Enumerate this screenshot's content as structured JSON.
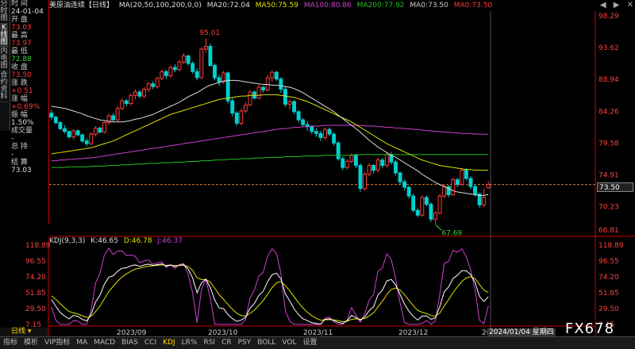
{
  "side_tabs": [
    "分时图",
    "K线图",
    "内电图",
    "合约资料"
  ],
  "info_panel": {
    "fields": [
      {
        "label": "时 间",
        "value": "24-01-04",
        "cls": "white"
      },
      {
        "label": "开 盘",
        "value": "73.03",
        "cls": "red"
      },
      {
        "label": "最 高",
        "value": "73.97",
        "cls": "red"
      },
      {
        "label": "最 低",
        "value": "72.88",
        "cls": "grn"
      },
      {
        "label": "收 盘",
        "value": "73.50",
        "cls": "red"
      },
      {
        "label": "涨 跌",
        "value": "+0.51",
        "cls": "red"
      },
      {
        "label": "涨 幅",
        "value": "+0.69%",
        "cls": "red"
      },
      {
        "label": "振 幅",
        "value": "1.50%",
        "cls": "white"
      },
      {
        "label": "成交量",
        "value": "-",
        "cls": "white"
      },
      {
        "label": "总 持",
        "value": "-",
        "cls": "white"
      },
      {
        "label": "结 算",
        "value": "73.03",
        "cls": "white"
      }
    ]
  },
  "header": {
    "instrument": "美原油连续",
    "period_tag": "【日线】",
    "ma_title": "MA(20,50,100,200,0,0)",
    "ma20": "MA20:72.04",
    "ma50": "MA50:75.59",
    "ma100": "MA100:80.86",
    "ma200": "MA200:77.92",
    "ma0a": "MA0:73.50",
    "ma0b": "MA0:73.50"
  },
  "top_right": {
    "left_arrow": "◀",
    "right_arrow": "▶",
    "close": "✕"
  },
  "price_axis": [
    "98.29",
    "93.62",
    "88.94",
    "84.26",
    "79.58",
    "74.91",
    "70.23",
    "66.81"
  ],
  "current_price_label": "73.50",
  "annotations": {
    "high": "95.01",
    "low": "67.69"
  },
  "kdj": {
    "title": "KDJ(9,3,3)",
    "k": "K:46.65",
    "d": "D:46.78",
    "j": "J:46.37",
    "axis": [
      "118.89",
      "96.55",
      "74.20",
      "51.85",
      "29.50",
      "7.15"
    ]
  },
  "x_axis": [
    "2023/09",
    "2023/10",
    "2023/11",
    "2023/12",
    "20"
  ],
  "cursor_date": "2024/01/04 星期四",
  "period_selector": {
    "label": "日线",
    "arrow": "▾"
  },
  "bottom_tabs": [
    "指标",
    "模析",
    "VIP指标",
    "MA",
    "MACD",
    "BIAS",
    "CCI",
    "KDJ",
    "LR%",
    "RSI",
    "CR",
    "PSY",
    "BOLL",
    "VOL",
    "设置"
  ],
  "watermark": "FX678",
  "colors": {
    "up": "#ff3b3b",
    "down": "#00d0d0",
    "ma20": "#dddddd",
    "ma50": "#e0e000",
    "ma100": "#d040d0",
    "ma200": "#20c020",
    "k": "#ffffff",
    "d": "#e0e000",
    "j": "#d040d0"
  },
  "chart_data": {
    "type": "candlestick",
    "series_note": "",
    "y_range": [
      66.81,
      98.29
    ],
    "candles": [
      [
        84.0,
        84.5,
        83.0,
        83.4
      ],
      [
        83.4,
        83.6,
        82.3,
        82.6
      ],
      [
        82.6,
        82.8,
        81.5,
        81.7
      ],
      [
        81.7,
        82.2,
        81.0,
        81.3
      ],
      [
        81.3,
        81.4,
        80.2,
        80.5
      ],
      [
        80.5,
        81.6,
        80.1,
        81.4
      ],
      [
        81.4,
        81.6,
        80.6,
        80.8
      ],
      [
        80.8,
        81.0,
        79.6,
        79.9
      ],
      [
        79.9,
        80.3,
        79.1,
        79.5
      ],
      [
        79.5,
        81.2,
        79.3,
        80.9
      ],
      [
        80.9,
        82.1,
        80.6,
        81.8
      ],
      [
        81.8,
        82.0,
        81.0,
        81.2
      ],
      [
        81.2,
        82.8,
        81.0,
        82.6
      ],
      [
        82.6,
        83.9,
        82.3,
        83.6
      ],
      [
        83.6,
        84.0,
        82.8,
        83.0
      ],
      [
        83.0,
        85.0,
        82.7,
        84.7
      ],
      [
        84.7,
        86.2,
        84.4,
        85.8
      ],
      [
        85.8,
        86.1,
        85.0,
        85.4
      ],
      [
        85.4,
        86.9,
        85.1,
        86.6
      ],
      [
        86.6,
        87.5,
        86.0,
        87.1
      ],
      [
        87.1,
        87.4,
        86.2,
        86.5
      ],
      [
        86.5,
        87.8,
        86.2,
        87.5
      ],
      [
        87.5,
        88.6,
        87.1,
        88.3
      ],
      [
        88.3,
        88.7,
        87.5,
        87.9
      ],
      [
        87.9,
        89.4,
        87.6,
        89.1
      ],
      [
        89.1,
        90.4,
        88.8,
        90.1
      ],
      [
        90.1,
        90.3,
        89.0,
        89.5
      ],
      [
        89.5,
        91.0,
        89.2,
        90.7
      ],
      [
        90.7,
        91.2,
        90.0,
        90.4
      ],
      [
        90.4,
        91.8,
        90.1,
        91.5
      ],
      [
        91.5,
        92.8,
        91.2,
        92.4
      ],
      [
        92.4,
        92.6,
        91.0,
        91.3
      ],
      [
        91.3,
        91.6,
        89.8,
        90.1
      ],
      [
        90.1,
        90.6,
        88.8,
        89.2
      ],
      [
        89.2,
        93.7,
        89.0,
        93.4
      ],
      [
        93.4,
        95.0,
        92.9,
        93.8
      ],
      [
        93.8,
        94.2,
        90.8,
        91.0
      ],
      [
        91.0,
        91.3,
        88.8,
        89.2
      ],
      [
        89.2,
        89.6,
        88.0,
        88.6
      ],
      [
        88.6,
        90.2,
        88.3,
        89.9
      ],
      [
        89.9,
        90.1,
        85.4,
        85.8
      ],
      [
        85.8,
        86.2,
        83.5,
        84.0
      ],
      [
        84.0,
        84.3,
        82.1,
        82.5
      ],
      [
        82.5,
        84.6,
        82.2,
        84.3
      ],
      [
        84.3,
        85.6,
        84.0,
        85.2
      ],
      [
        85.2,
        87.4,
        85.0,
        87.1
      ],
      [
        87.1,
        87.3,
        86.0,
        86.2
      ],
      [
        86.2,
        88.2,
        86.0,
        87.8
      ],
      [
        87.8,
        88.0,
        87.0,
        87.4
      ],
      [
        87.4,
        89.6,
        87.2,
        89.2
      ],
      [
        89.2,
        90.3,
        88.6,
        90.0
      ],
      [
        90.0,
        90.2,
        88.7,
        89.0
      ],
      [
        89.0,
        89.3,
        87.0,
        87.5
      ],
      [
        87.5,
        87.9,
        84.9,
        85.3
      ],
      [
        85.3,
        86.0,
        84.5,
        85.7
      ],
      [
        85.7,
        85.9,
        83.8,
        84.2
      ],
      [
        84.2,
        84.4,
        82.6,
        83.0
      ],
      [
        83.0,
        83.3,
        82.0,
        82.3
      ],
      [
        82.3,
        82.8,
        81.4,
        82.0
      ],
      [
        82.0,
        82.2,
        80.9,
        81.3
      ],
      [
        81.3,
        81.8,
        80.5,
        81.0
      ],
      [
        81.0,
        81.4,
        79.9,
        80.4
      ],
      [
        80.4,
        81.9,
        80.1,
        81.6
      ],
      [
        81.6,
        81.9,
        80.6,
        80.9
      ],
      [
        80.9,
        81.2,
        79.2,
        79.6
      ],
      [
        79.6,
        79.9,
        77.0,
        77.3
      ],
      [
        77.3,
        77.6,
        75.6,
        76.0
      ],
      [
        76.0,
        77.2,
        75.7,
        76.9
      ],
      [
        76.9,
        78.1,
        76.6,
        77.8
      ],
      [
        77.8,
        78.0,
        75.9,
        76.3
      ],
      [
        76.3,
        76.6,
        72.4,
        72.9
      ],
      [
        72.9,
        75.3,
        72.6,
        75.0
      ],
      [
        75.0,
        76.6,
        74.7,
        76.3
      ],
      [
        76.3,
        76.5,
        75.1,
        75.6
      ],
      [
        75.6,
        77.4,
        75.3,
        77.1
      ],
      [
        77.1,
        77.4,
        75.9,
        76.3
      ],
      [
        76.3,
        78.2,
        76.0,
        77.9
      ],
      [
        77.9,
        78.3,
        76.4,
        76.8
      ],
      [
        76.8,
        77.1,
        74.8,
        75.2
      ],
      [
        75.2,
        75.4,
        73.5,
        73.9
      ],
      [
        73.9,
        74.2,
        72.6,
        73.1
      ],
      [
        73.1,
        73.3,
        71.4,
        71.8
      ],
      [
        71.8,
        72.2,
        69.4,
        69.7
      ],
      [
        69.7,
        70.1,
        68.7,
        69.0
      ],
      [
        69.0,
        71.9,
        68.8,
        71.6
      ],
      [
        71.6,
        71.9,
        70.3,
        70.6
      ],
      [
        70.6,
        70.9,
        68.0,
        68.4
      ],
      [
        68.4,
        69.6,
        67.7,
        69.3
      ],
      [
        69.3,
        72.1,
        69.1,
        71.8
      ],
      [
        71.8,
        73.5,
        71.5,
        73.2
      ],
      [
        73.2,
        73.4,
        71.6,
        72.0
      ],
      [
        72.0,
        74.5,
        71.8,
        74.2
      ],
      [
        74.2,
        74.5,
        73.1,
        73.5
      ],
      [
        73.5,
        75.9,
        73.3,
        75.6
      ],
      [
        75.6,
        75.9,
        74.1,
        74.4
      ],
      [
        74.4,
        74.7,
        72.8,
        73.2
      ],
      [
        73.2,
        73.5,
        71.7,
        72.1
      ],
      [
        72.1,
        72.3,
        70.1,
        70.5
      ],
      [
        70.5,
        72.9,
        70.2,
        71.6
      ],
      [
        73.03,
        73.97,
        72.88,
        73.5
      ]
    ],
    "ma20": [
      85.0,
      84.9,
      84.8,
      84.7,
      84.5,
      84.3,
      84.1,
      83.9,
      83.6,
      83.4,
      83.2,
      83.0,
      82.9,
      82.8,
      82.7,
      82.7,
      82.7,
      82.8,
      82.9,
      83.1,
      83.2,
      83.4,
      83.6,
      83.8,
      84.1,
      84.4,
      84.7,
      85.0,
      85.3,
      85.6,
      86.0,
      86.4,
      86.7,
      87.0,
      87.4,
      87.8,
      88.1,
      88.3,
      88.5,
      88.7,
      88.8,
      88.8,
      88.8,
      88.7,
      88.6,
      88.5,
      88.4,
      88.3,
      88.2,
      88.2,
      88.1,
      88.1,
      88.0,
      87.9,
      87.8,
      87.6,
      87.3,
      87.0,
      86.6,
      86.2,
      85.8,
      85.4,
      85.0,
      84.6,
      84.2,
      83.7,
      83.2,
      82.7,
      82.2,
      81.7,
      81.2,
      80.6,
      80.0,
      79.5,
      79.0,
      78.6,
      78.2,
      77.8,
      77.5,
      77.1,
      76.7,
      76.3,
      75.9,
      75.5,
      75.0,
      74.6,
      74.2,
      73.8,
      73.5,
      73.2,
      72.9,
      72.6,
      72.4,
      72.3,
      72.2,
      72.1,
      72.0,
      71.9,
      71.9,
      72.04
    ],
    "ma50": [
      78.0,
      78.1,
      78.2,
      78.3,
      78.4,
      78.5,
      78.6,
      78.7,
      78.8,
      78.9,
      79.1,
      79.3,
      79.5,
      79.7,
      79.9,
      80.2,
      80.5,
      80.8,
      81.1,
      81.4,
      81.7,
      82.0,
      82.3,
      82.6,
      82.9,
      83.2,
      83.5,
      83.8,
      84.0,
      84.2,
      84.4,
      84.6,
      84.8,
      85.0,
      85.2,
      85.4,
      85.6,
      85.8,
      86.0,
      86.1,
      86.2,
      86.3,
      86.4,
      86.5,
      86.5,
      86.6,
      86.6,
      86.6,
      86.7,
      86.7,
      86.7,
      86.7,
      86.6,
      86.5,
      86.4,
      86.3,
      86.1,
      85.9,
      85.7,
      85.4,
      85.1,
      84.8,
      84.5,
      84.2,
      83.9,
      83.6,
      83.3,
      83.0,
      82.7,
      82.3,
      81.9,
      81.5,
      81.1,
      80.7,
      80.3,
      79.9,
      79.5,
      79.2,
      78.9,
      78.6,
      78.3,
      78.0,
      77.7,
      77.4,
      77.1,
      76.9,
      76.7,
      76.5,
      76.3,
      76.2,
      76.1,
      76.0,
      75.9,
      75.8,
      75.7,
      75.7,
      75.6,
      75.6,
      75.6,
      75.59
    ],
    "ma100": [
      77.0,
      77.0,
      77.1,
      77.1,
      77.2,
      77.2,
      77.3,
      77.3,
      77.4,
      77.4,
      77.5,
      77.6,
      77.7,
      77.8,
      77.9,
      78.0,
      78.1,
      78.2,
      78.3,
      78.4,
      78.5,
      78.6,
      78.7,
      78.8,
      78.9,
      79.0,
      79.1,
      79.2,
      79.3,
      79.4,
      79.5,
      79.6,
      79.7,
      79.8,
      79.9,
      80.0,
      80.1,
      80.2,
      80.3,
      80.4,
      80.5,
      80.6,
      80.7,
      80.8,
      80.9,
      81.0,
      81.1,
      81.2,
      81.3,
      81.4,
      81.5,
      81.6,
      81.7,
      81.7,
      81.8,
      81.9,
      81.9,
      82.0,
      82.0,
      82.1,
      82.1,
      82.1,
      82.2,
      82.2,
      82.2,
      82.2,
      82.2,
      82.2,
      82.2,
      82.2,
      82.2,
      82.1,
      82.1,
      82.1,
      82.0,
      82.0,
      81.9,
      81.9,
      81.8,
      81.8,
      81.7,
      81.7,
      81.6,
      81.6,
      81.5,
      81.4,
      81.4,
      81.3,
      81.3,
      81.2,
      81.2,
      81.1,
      81.1,
      81.0,
      81.0,
      81.0,
      80.9,
      80.9,
      80.9,
      80.86
    ],
    "ma200": [
      76.0,
      76.0,
      76.0,
      76.0,
      76.1,
      76.1,
      76.1,
      76.1,
      76.1,
      76.2,
      76.2,
      76.2,
      76.2,
      76.3,
      76.3,
      76.3,
      76.4,
      76.4,
      76.4,
      76.5,
      76.5,
      76.5,
      76.6,
      76.6,
      76.6,
      76.7,
      76.7,
      76.7,
      76.8,
      76.8,
      76.8,
      76.9,
      76.9,
      76.9,
      77.0,
      77.0,
      77.0,
      77.1,
      77.1,
      77.1,
      77.2,
      77.2,
      77.2,
      77.3,
      77.3,
      77.3,
      77.4,
      77.4,
      77.4,
      77.5,
      77.5,
      77.5,
      77.5,
      77.6,
      77.6,
      77.6,
      77.6,
      77.7,
      77.7,
      77.7,
      77.7,
      77.7,
      77.8,
      77.8,
      77.8,
      77.8,
      77.8,
      77.8,
      77.8,
      77.9,
      77.9,
      77.9,
      77.9,
      77.9,
      77.9,
      77.9,
      77.9,
      77.9,
      77.9,
      77.9,
      77.9,
      77.9,
      77.9,
      77.9,
      77.9,
      77.9,
      77.9,
      77.9,
      77.9,
      77.9,
      77.9,
      77.9,
      77.9,
      77.9,
      77.9,
      77.9,
      77.9,
      77.9,
      77.9,
      77.92
    ],
    "kdj_range": [
      7.15,
      118.89
    ]
  }
}
